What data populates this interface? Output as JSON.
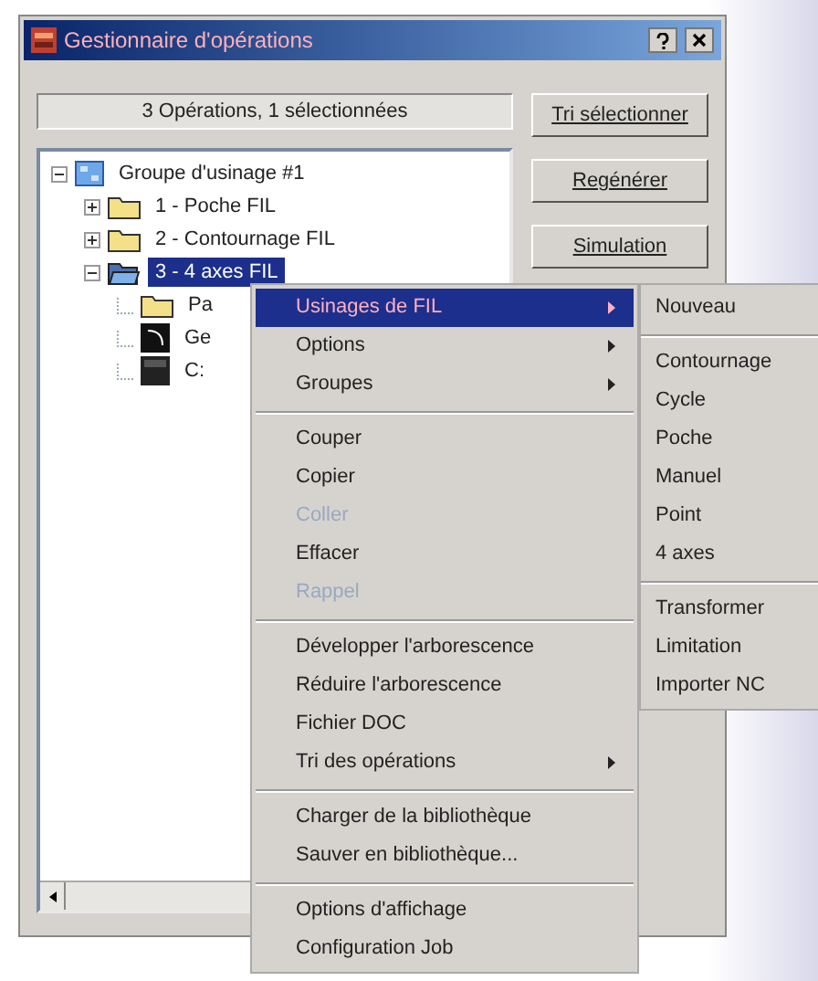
{
  "window": {
    "title": "Gestionnaire d'opérations"
  },
  "status": "3 Opérations, 1 sélectionnées",
  "buttons": [
    {
      "label": "Tri sélectionner"
    },
    {
      "label": "Regénérer"
    },
    {
      "label": "Simulation"
    }
  ],
  "tree": [
    {
      "label": "Groupe d'usinage #1",
      "kind": "group",
      "expanded": true,
      "selected": false,
      "children": [
        {
          "label": "1 - Poche FIL",
          "kind": "folder",
          "expanded": false,
          "selected": false
        },
        {
          "label": "2 - Contournage FIL",
          "kind": "folder",
          "expanded": false,
          "selected": false
        },
        {
          "label": "3 - 4 axes FIL",
          "kind": "open-folder",
          "expanded": true,
          "selected": true,
          "children": [
            {
              "label": "Pa",
              "kind": "folder",
              "selected": false
            },
            {
              "label": "Ge",
              "kind": "geometry",
              "selected": false
            },
            {
              "label": "C:",
              "kind": "dark",
              "selected": false
            }
          ]
        }
      ]
    }
  ],
  "context_menu": [
    {
      "kind": "item",
      "label": "Usinages de FIL",
      "submenu": true,
      "selected": true,
      "disabled": false
    },
    {
      "kind": "item",
      "label": "Options",
      "submenu": true,
      "selected": false,
      "disabled": false
    },
    {
      "kind": "item",
      "label": "Groupes",
      "submenu": true,
      "selected": false,
      "disabled": false
    },
    {
      "kind": "separator"
    },
    {
      "kind": "item",
      "label": "Couper",
      "submenu": false,
      "selected": false,
      "disabled": false
    },
    {
      "kind": "item",
      "label": "Copier",
      "submenu": false,
      "selected": false,
      "disabled": false
    },
    {
      "kind": "item",
      "label": "Coller",
      "submenu": false,
      "selected": false,
      "disabled": true
    },
    {
      "kind": "item",
      "label": "Effacer",
      "submenu": false,
      "selected": false,
      "disabled": false
    },
    {
      "kind": "item",
      "label": "Rappel",
      "submenu": false,
      "selected": false,
      "disabled": true
    },
    {
      "kind": "separator"
    },
    {
      "kind": "item",
      "label": "Développer l'arborescence",
      "submenu": false,
      "selected": false,
      "disabled": false
    },
    {
      "kind": "item",
      "label": "Réduire l'arborescence",
      "submenu": false,
      "selected": false,
      "disabled": false
    },
    {
      "kind": "item",
      "label": "Fichier DOC",
      "submenu": false,
      "selected": false,
      "disabled": false
    },
    {
      "kind": "item",
      "label": "Tri des opérations",
      "submenu": true,
      "selected": false,
      "disabled": false
    },
    {
      "kind": "separator"
    },
    {
      "kind": "item",
      "label": "Charger de la bibliothèque",
      "submenu": false,
      "selected": false,
      "disabled": false
    },
    {
      "kind": "item",
      "label": "Sauver en bibliothèque...",
      "submenu": false,
      "selected": false,
      "disabled": false
    },
    {
      "kind": "separator"
    },
    {
      "kind": "item",
      "label": "Options d'affichage",
      "submenu": false,
      "selected": false,
      "disabled": false
    },
    {
      "kind": "item",
      "label": "Configuration Job",
      "submenu": false,
      "selected": false,
      "disabled": false
    }
  ],
  "submenu": [
    {
      "kind": "item",
      "label": "Nouveau"
    },
    {
      "kind": "separator"
    },
    {
      "kind": "item",
      "label": "Contournage"
    },
    {
      "kind": "item",
      "label": "Cycle"
    },
    {
      "kind": "item",
      "label": "Poche"
    },
    {
      "kind": "item",
      "label": "Manuel"
    },
    {
      "kind": "item",
      "label": "Point"
    },
    {
      "kind": "item",
      "label": "4 axes"
    },
    {
      "kind": "separator"
    },
    {
      "kind": "item",
      "label": "Transformer"
    },
    {
      "kind": "item",
      "label": "Limitation"
    },
    {
      "kind": "item",
      "label": "Importer NC"
    }
  ]
}
